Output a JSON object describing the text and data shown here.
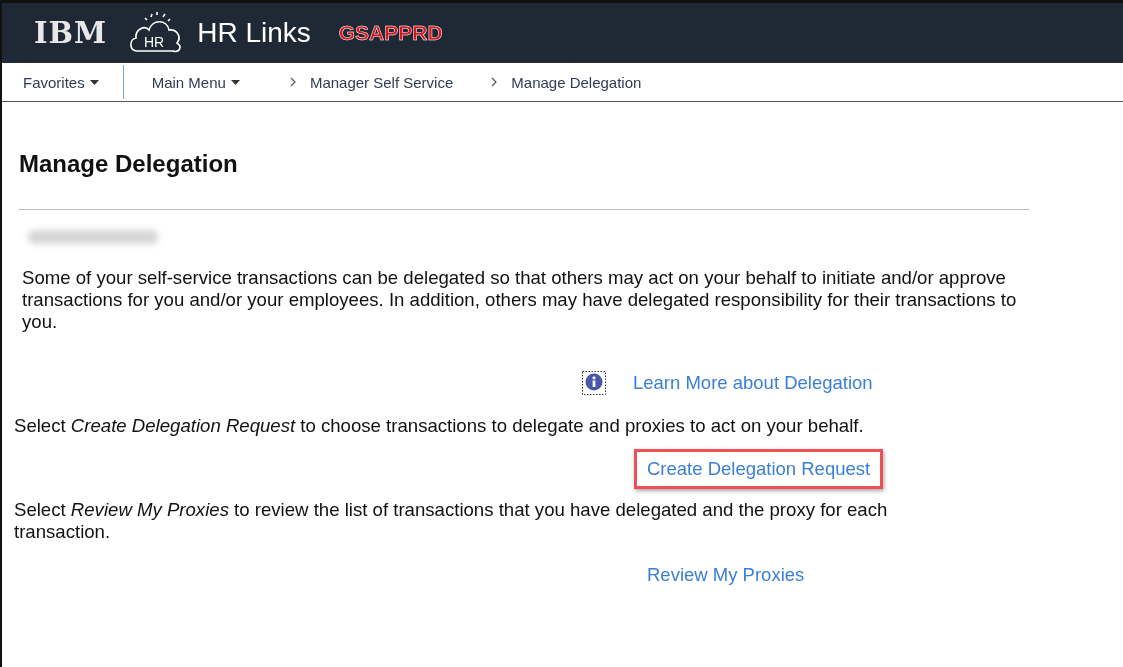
{
  "header": {
    "logo": "IBM",
    "cloud_logo_text": "HR",
    "app_title": "HR Links",
    "environment": "GSAPPRD"
  },
  "nav": {
    "menus": [
      {
        "label": "Favorites",
        "has_dropdown": true
      },
      {
        "label": "Main Menu",
        "has_dropdown": true
      }
    ],
    "breadcrumbs": [
      "Manager Self Service",
      "Manage Delegation"
    ]
  },
  "page": {
    "title": "Manage Delegation",
    "intro": "Some of your self-service transactions can be delegated so that others may act on your behalf to initiate and/or approve transactions for you and/or your employees. In addition, others may have delegated responsibility for their transactions to you.",
    "sections": [
      {
        "kind": "info_link",
        "link": "Learn More about Delegation",
        "highlighted": false
      },
      {
        "kind": "instruction",
        "text": "Select *Create Delegation Request* to choose transactions to delegate and proxies to act on your behalf."
      },
      {
        "kind": "link",
        "link": "Create Delegation Request",
        "highlighted": true
      },
      {
        "kind": "instruction",
        "text": "Select *Review My Proxies* to review the list of transactions that you have delegated and the proxy for each transaction."
      },
      {
        "kind": "link",
        "link": "Review My Proxies",
        "highlighted": false
      }
    ]
  }
}
